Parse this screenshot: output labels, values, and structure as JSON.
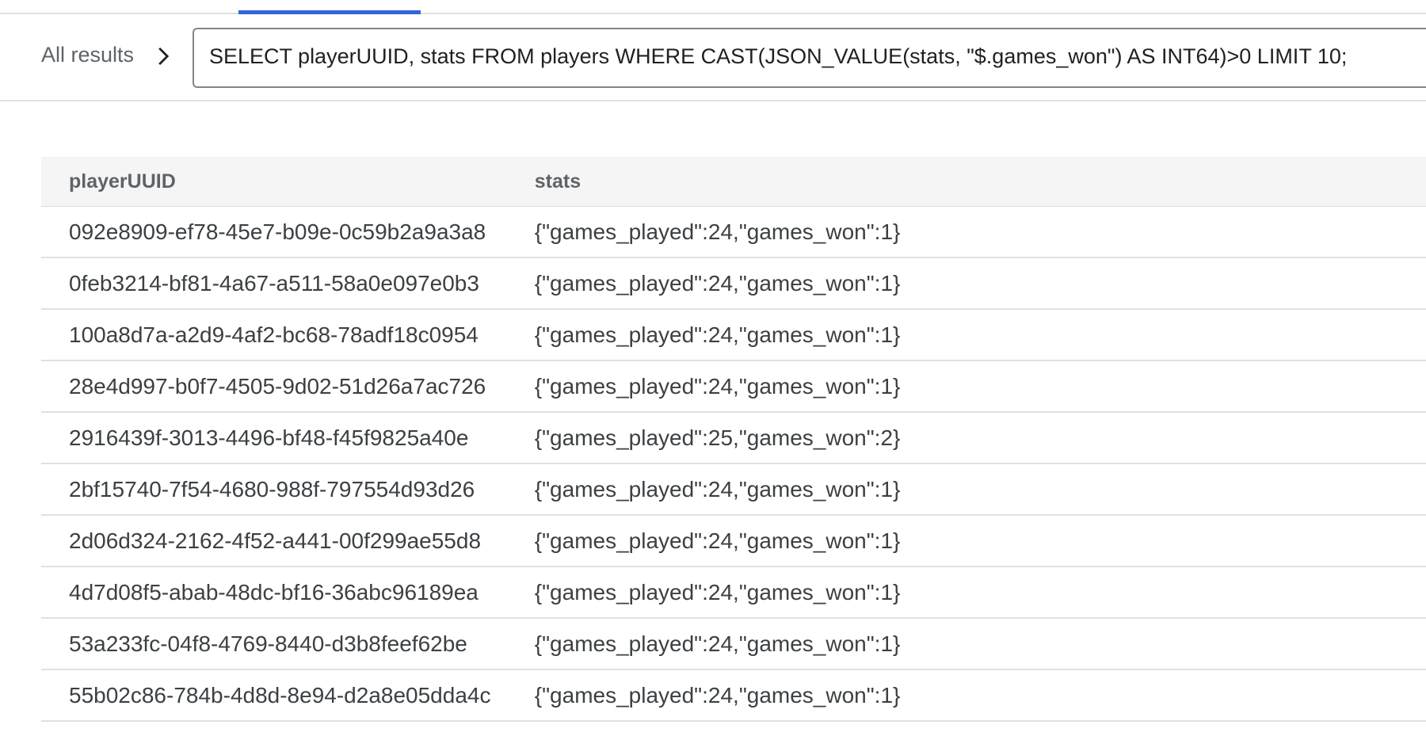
{
  "breadcrumb": {
    "all_results_label": "All results"
  },
  "query": {
    "text": "SELECT playerUUID, stats FROM players WHERE CAST(JSON_VALUE(stats, \"$.games_won\") AS INT64)>0 LIMIT 10;"
  },
  "table": {
    "columns": [
      "playerUUID",
      "stats"
    ],
    "rows": [
      {
        "playerUUID": "092e8909-ef78-45e7-b09e-0c59b2a9a3a8",
        "stats": "{\"games_played\":24,\"games_won\":1}"
      },
      {
        "playerUUID": "0feb3214-bf81-4a67-a511-58a0e097e0b3",
        "stats": "{\"games_played\":24,\"games_won\":1}"
      },
      {
        "playerUUID": "100a8d7a-a2d9-4af2-bc68-78adf18c0954",
        "stats": "{\"games_played\":24,\"games_won\":1}"
      },
      {
        "playerUUID": "28e4d997-b0f7-4505-9d02-51d26a7ac726",
        "stats": "{\"games_played\":24,\"games_won\":1}"
      },
      {
        "playerUUID": "2916439f-3013-4496-bf48-f45f9825a40e",
        "stats": "{\"games_played\":25,\"games_won\":2}"
      },
      {
        "playerUUID": "2bf15740-7f54-4680-988f-797554d93d26",
        "stats": "{\"games_played\":24,\"games_won\":1}"
      },
      {
        "playerUUID": "2d06d324-2162-4f52-a441-00f299ae55d8",
        "stats": "{\"games_played\":24,\"games_won\":1}"
      },
      {
        "playerUUID": "4d7d08f5-abab-48dc-bf16-36abc96189ea",
        "stats": "{\"games_played\":24,\"games_won\":1}"
      },
      {
        "playerUUID": "53a233fc-04f8-4769-8440-d3b8feef62be",
        "stats": "{\"games_played\":24,\"games_won\":1}"
      },
      {
        "playerUUID": "55b02c86-784b-4d8d-8e94-d2a8e05dda4c",
        "stats": "{\"games_played\":24,\"games_won\":1}"
      }
    ]
  },
  "icons": {
    "breadcrumb_separator": "chevron-right-icon"
  },
  "colors": {
    "active_tab": "#3367d6",
    "header_bg": "#f5f5f5",
    "text": "#3c4043"
  }
}
